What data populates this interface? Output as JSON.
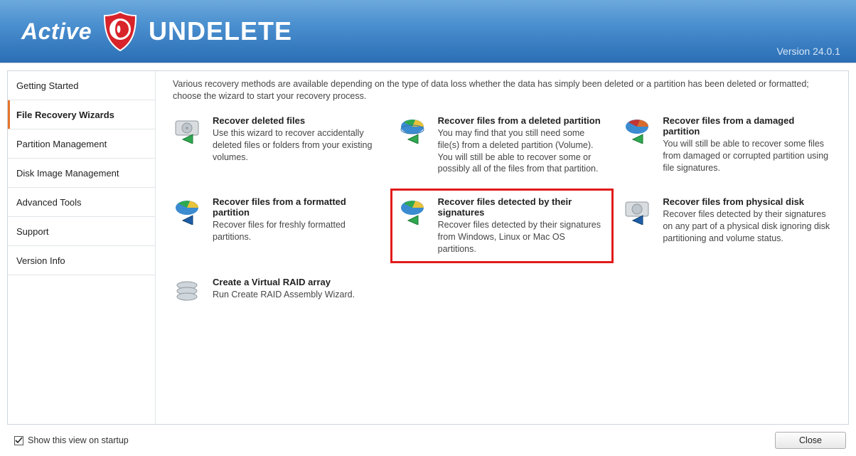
{
  "header": {
    "brand_prefix": "Active",
    "brand_main": "UNDELETE",
    "version_label": "Version 24.0.1"
  },
  "sidebar": {
    "items": [
      {
        "label": "Getting Started"
      },
      {
        "label": "File Recovery Wizards"
      },
      {
        "label": "Partition Management"
      },
      {
        "label": "Disk Image Management"
      },
      {
        "label": "Advanced Tools"
      },
      {
        "label": "Support"
      },
      {
        "label": "Version Info"
      }
    ],
    "selected_index": 1
  },
  "content": {
    "intro": "Various recovery methods are available depending on the type of data loss whether the data has simply been deleted or a partition has been deleted or formatted; choose the wizard to start your recovery process.",
    "cards": [
      {
        "title": "Recover deleted files",
        "desc": "Use this wizard to recover accidentally deleted files or folders from your existing volumes."
      },
      {
        "title": "Recover files from a deleted partition",
        "desc": "You may find that you still need some file(s) from a deleted partition (Volume). You will still be able to recover some or possibly all of the files from that partition."
      },
      {
        "title": "Recover files from a damaged partition",
        "desc": "You will still be able to recover some files from damaged or corrupted partition using file signatures."
      },
      {
        "title": "Recover files from a formatted partition",
        "desc": "Recover files for freshly formatted partitions."
      },
      {
        "title": "Recover files detected by their signatures",
        "desc": "Recover files detected by their signatures from Windows, Linux or Mac OS partitions."
      },
      {
        "title": "Recover files from physical disk",
        "desc": "Recover files detected by their signatures on any part of a physical disk ignoring disk partitioning and volume status."
      },
      {
        "title": "Create a Virtual RAID array",
        "desc": "Run Create RAID Assembly Wizard."
      }
    ]
  },
  "footer": {
    "show_on_startup_label": "Show this view on startup",
    "show_on_startup_checked": true,
    "close_label": "Close"
  }
}
